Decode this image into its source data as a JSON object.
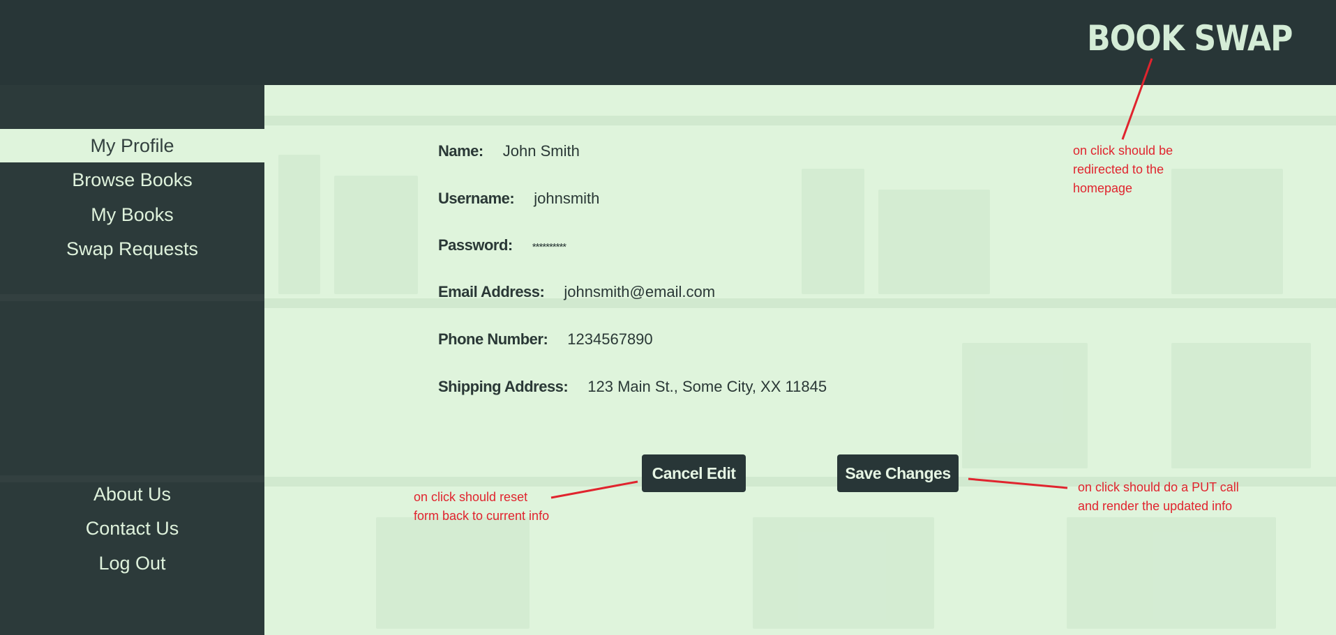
{
  "brand": "BOOK SWAP",
  "sidebar": {
    "items": [
      {
        "label": "My Profile"
      },
      {
        "label": "Browse Books"
      },
      {
        "label": "My Books"
      },
      {
        "label": "Swap Requests"
      }
    ],
    "footer_items": [
      {
        "label": "About Us"
      },
      {
        "label": "Contact Us"
      },
      {
        "label": "Log Out"
      }
    ]
  },
  "profile": {
    "fields": [
      {
        "label": "Name:",
        "value": "John Smith"
      },
      {
        "label": "Username:",
        "value": "johnsmith"
      },
      {
        "label": "Password:",
        "value": "**********"
      },
      {
        "label": "Email Address:",
        "value": "johnsmith@email.com"
      },
      {
        "label": "Phone Number:",
        "value": "1234567890"
      },
      {
        "label": "Shipping Address:",
        "value": "123 Main St., Some City, XX 11845"
      }
    ]
  },
  "actions": {
    "cancel_label": "Cancel Edit",
    "save_label": "Save Changes"
  },
  "annotations": {
    "brand_note": "on click should be redirected to the homepage",
    "cancel_note": "on click should reset form back to current info",
    "save_note": "on click should do a PUT call and render the updated info"
  },
  "colors": {
    "header_bg": "#283637",
    "sidebar_bg": "#2c3a3a",
    "main_bg": "#dff4dc",
    "annotation": "#e0242e"
  }
}
